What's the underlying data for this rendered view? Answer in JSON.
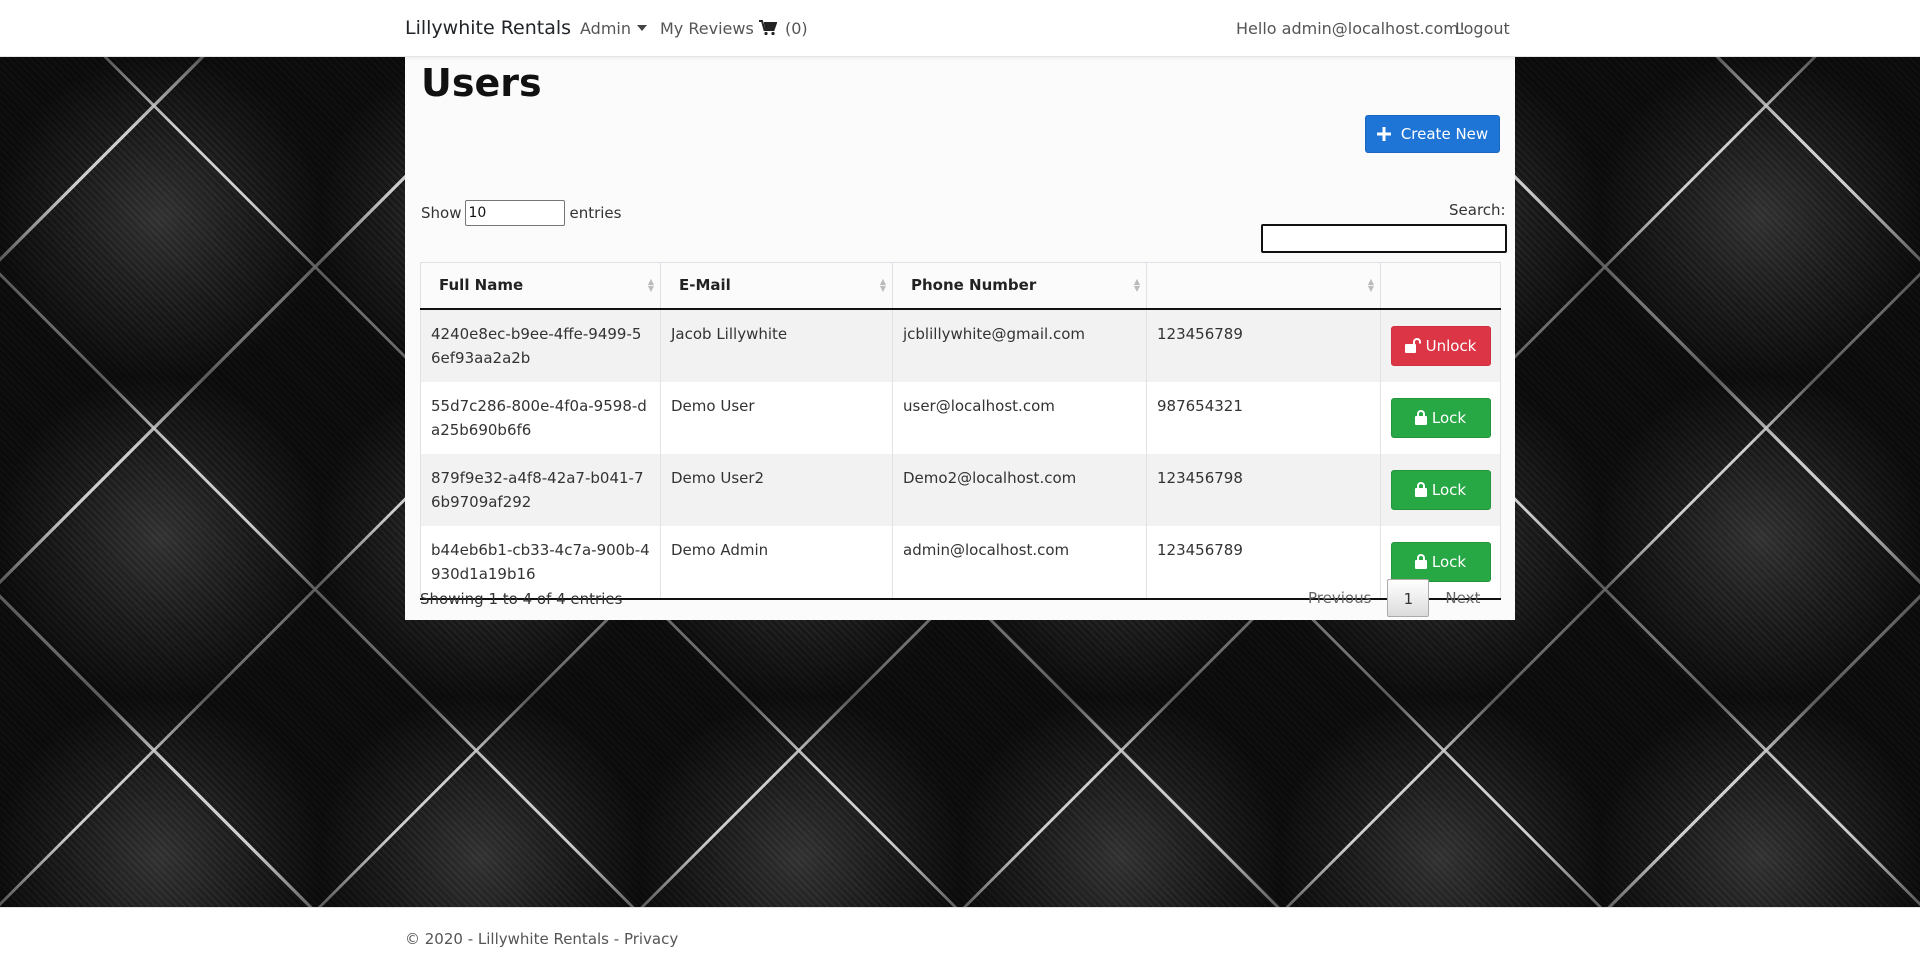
{
  "navbar": {
    "brand": "Lillywhite Rentals",
    "admin_label": "Admin",
    "reviews_label": "My Reviews",
    "cart_count": "(0)",
    "greeting": "Hello admin@localhost.com!",
    "logout_label": "Logout"
  },
  "main": {
    "title": "Users",
    "create_button_label": "Create New",
    "length": {
      "prefix": "Show",
      "value": "10",
      "suffix": "entries"
    },
    "search_label": "Search:",
    "table": {
      "headers": [
        "Full Name",
        "E-Mail",
        "Phone Number",
        "",
        ""
      ],
      "rows": [
        {
          "c1": "4240e8ec-b9ee-4ffe-9499-56ef93aa2a2b",
          "c2": "Jacob Lillywhite",
          "c3": "jcblillywhite@gmail.com",
          "c4": "123456789",
          "action": "Unlock"
        },
        {
          "c1": "55d7c286-800e-4f0a-9598-da25b690b6f6",
          "c2": "Demo User",
          "c3": "user@localhost.com",
          "c4": "987654321",
          "action": "Lock"
        },
        {
          "c1": "879f9e32-a4f8-42a7-b041-76b9709af292",
          "c2": "Demo User2",
          "c3": "Demo2@localhost.com",
          "c4": "123456798",
          "action": "Lock"
        },
        {
          "c1": "b44eb6b1-cb33-4c7a-900b-4930d1a19b16",
          "c2": "Demo Admin",
          "c3": "admin@localhost.com",
          "c4": "123456789",
          "action": "Lock"
        }
      ]
    },
    "info": "Showing 1 to 4 of 4 entries",
    "pagination": {
      "previous": "Previous",
      "current": "1",
      "next": "Next"
    }
  },
  "footer": {
    "text": "© 2020 - Lillywhite Rentals - ",
    "privacy": "Privacy"
  },
  "colors": {
    "create": "#1f75d6",
    "unlock": "#dc3545",
    "lock": "#28a745"
  },
  "icons": {
    "create": "plus-icon",
    "unlock": "unlock-icon",
    "lock": "lock-icon",
    "cart": "cart-icon"
  }
}
